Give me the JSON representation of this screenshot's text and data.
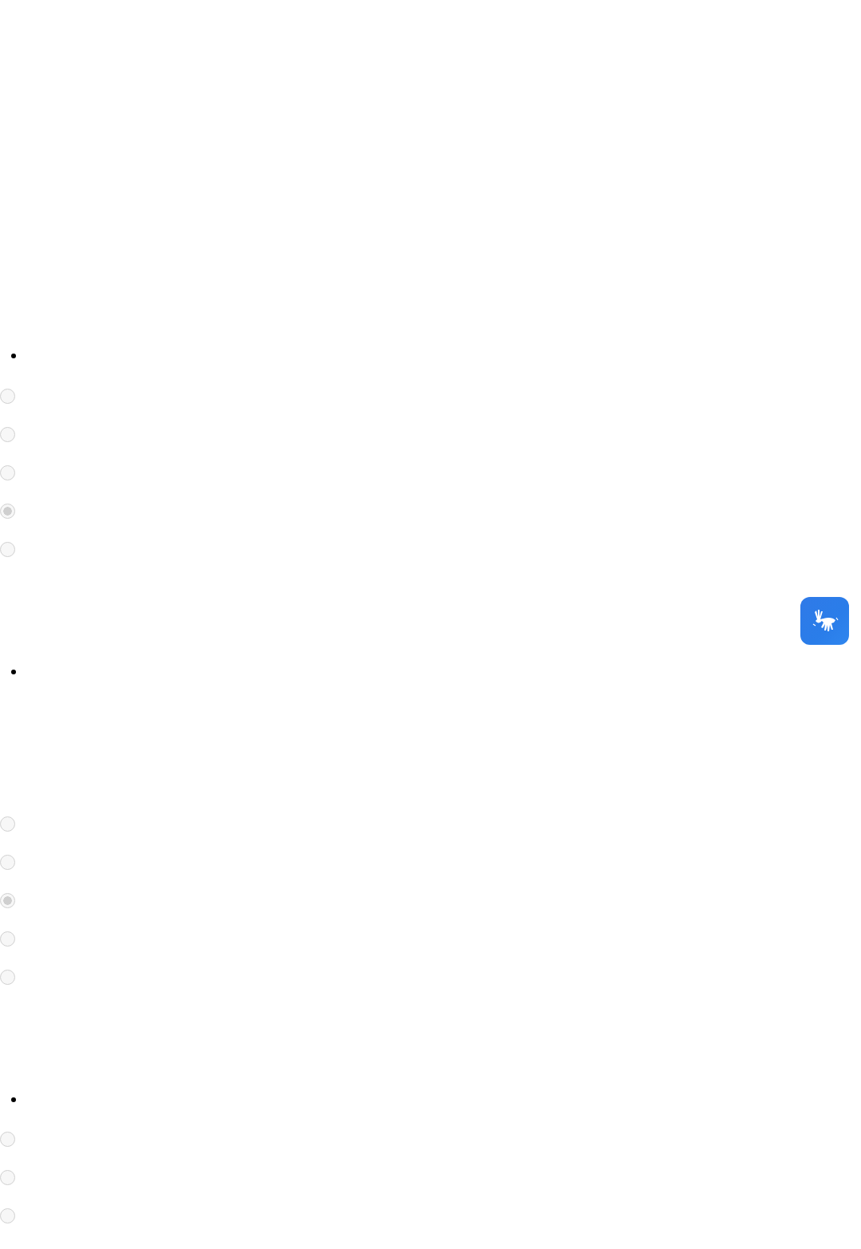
{
  "groups": [
    {
      "options": [
        {
          "selected": false
        },
        {
          "selected": false
        },
        {
          "selected": false
        },
        {
          "selected": true
        },
        {
          "selected": false
        }
      ]
    },
    {
      "options": [
        {
          "selected": false
        },
        {
          "selected": false
        },
        {
          "selected": true
        },
        {
          "selected": false
        },
        {
          "selected": false
        }
      ]
    },
    {
      "options": [
        {
          "selected": false
        },
        {
          "selected": false
        },
        {
          "selected": false
        }
      ]
    }
  ]
}
